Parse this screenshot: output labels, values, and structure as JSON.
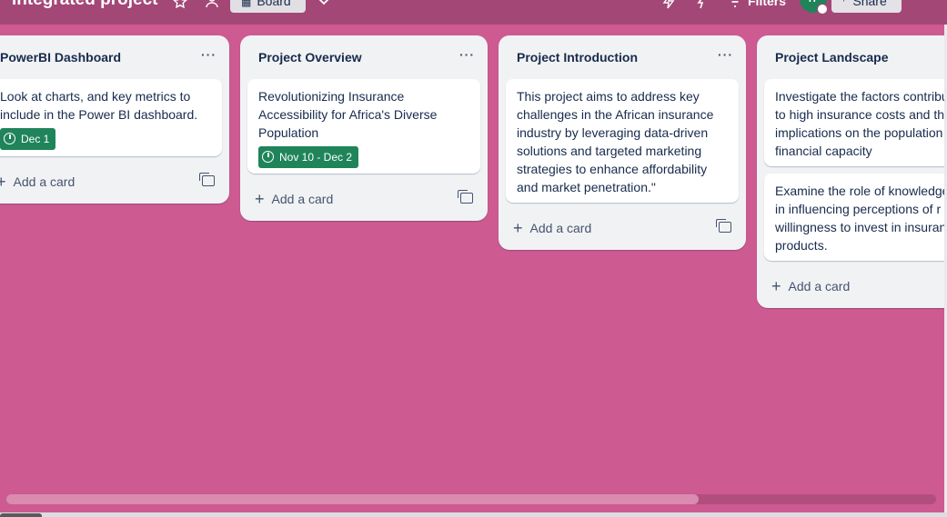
{
  "header": {
    "board_title": "Integrated project",
    "view_label": "Board",
    "filters_label": "Filters",
    "avatar_initials": "TP",
    "share_label": "Share",
    "more_label": "···"
  },
  "lists": [
    {
      "title": "PowerBI Dashboard",
      "more": "···",
      "cards": [
        {
          "text": "Look at charts, and key metrics to include in the Power BI dashboard.",
          "due": "Dec 1"
        }
      ],
      "add_label": "Add a card"
    },
    {
      "title": "Project Overview",
      "more": "···",
      "cards": [
        {
          "text": "Revolutionizing Insurance Accessibility for Africa's Diverse Population",
          "due": "Nov 10 - Dec 2"
        }
      ],
      "add_label": "Add a card"
    },
    {
      "title": "Project Introduction",
      "more": "···",
      "cards": [
        {
          "text": "This project aims to address key challenges in the African insurance industry by leveraging data-driven solutions and targeted marketing strategies to enhance affordability and market penetration.\""
        }
      ],
      "add_label": "Add a card"
    },
    {
      "title": "Project Landscape",
      "cards": [
        {
          "text": "Investigate the factors contribu to high insurance costs and th implications on the population financial capacity"
        },
        {
          "text": "Examine the role of knowledge in influencing perceptions of r willingness to invest in insuran products."
        }
      ],
      "add_label": "Add a card"
    }
  ],
  "colors": {
    "board_bg": "#cd5a91",
    "header_bg": "#a34777",
    "due_badge": "#1f845a",
    "list_bg": "#f1f2f4"
  },
  "scrollbar": {
    "position_fraction": 0.0,
    "visible_fraction": 0.75
  }
}
